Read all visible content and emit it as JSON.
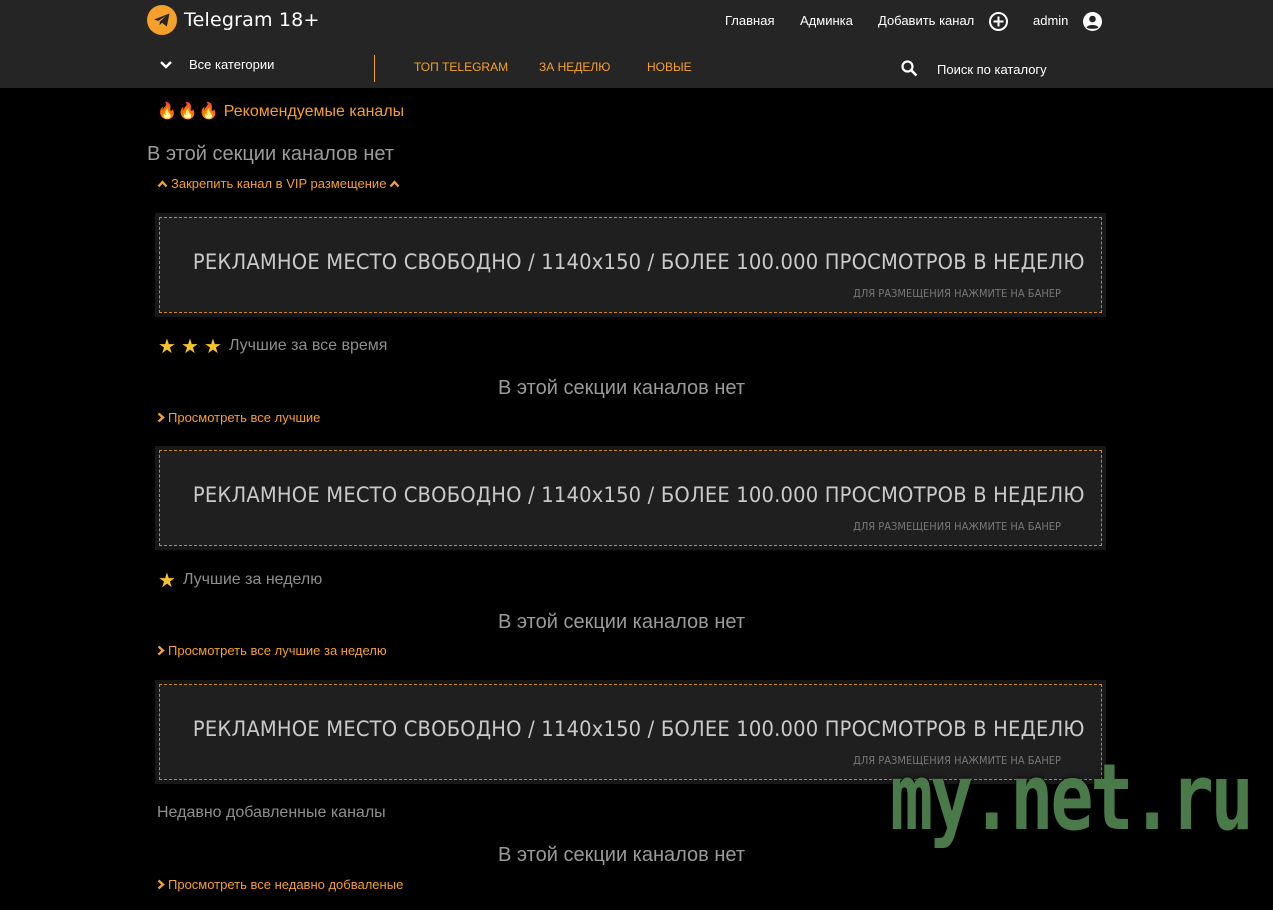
{
  "header": {
    "brand": "Telegram 18+",
    "nav": {
      "home": "Главная",
      "admin_panel": "Админка",
      "add_channel": "Добавить канал",
      "user": "admin"
    },
    "categories": "Все категории",
    "tabs": [
      "ТОП TELEGRAM",
      "ЗА НЕДЕЛЮ",
      "НОВЫЕ"
    ],
    "search": "Поиск по каталогу"
  },
  "sections": {
    "recommended": {
      "title": "Рекомендуемые каналы",
      "empty": "В этой секции каналов нет",
      "link": "Закрепить канал в VIP размещение"
    },
    "best_all_time": {
      "title": "Лучшие за все время",
      "empty": "В этой секции каналов нет",
      "link": "Просмотреть все лучшие"
    },
    "best_week": {
      "title": "Лучшие за неделю",
      "empty": "В этой секции каналов нет",
      "link": "Просмотреть все лучшие за неделю"
    },
    "recent": {
      "title": "Недавно добавленные каналы",
      "empty": "В этой секции каналов нет",
      "link": "Просмотреть все недавно добваленые"
    }
  },
  "banner": {
    "main": "РЕКЛАМНОЕ МЕСТО СВОБОДНО / 1140x150 / БОЛЕЕ 100.000 ПРОСМОТРОВ В НЕДЕЛЮ",
    "sub": "ДЛЯ РАЗМЕЩЕНИЯ НАЖМИТЕ НА БАНЕР"
  },
  "watermark": "my.net.ru",
  "colors": {
    "accent": "#f5a02a",
    "header_bg": "#252525",
    "page_bg": "#000000",
    "star": "#f5c32a"
  },
  "icons": {
    "logo": "telegram-plane-icon",
    "add": "plus-circle-icon",
    "user": "user-circle-icon",
    "categories": "chevron-down-icon",
    "search": "search-icon",
    "links_up": "chevron-up-icon",
    "links_right": "chevron-right-icon"
  }
}
